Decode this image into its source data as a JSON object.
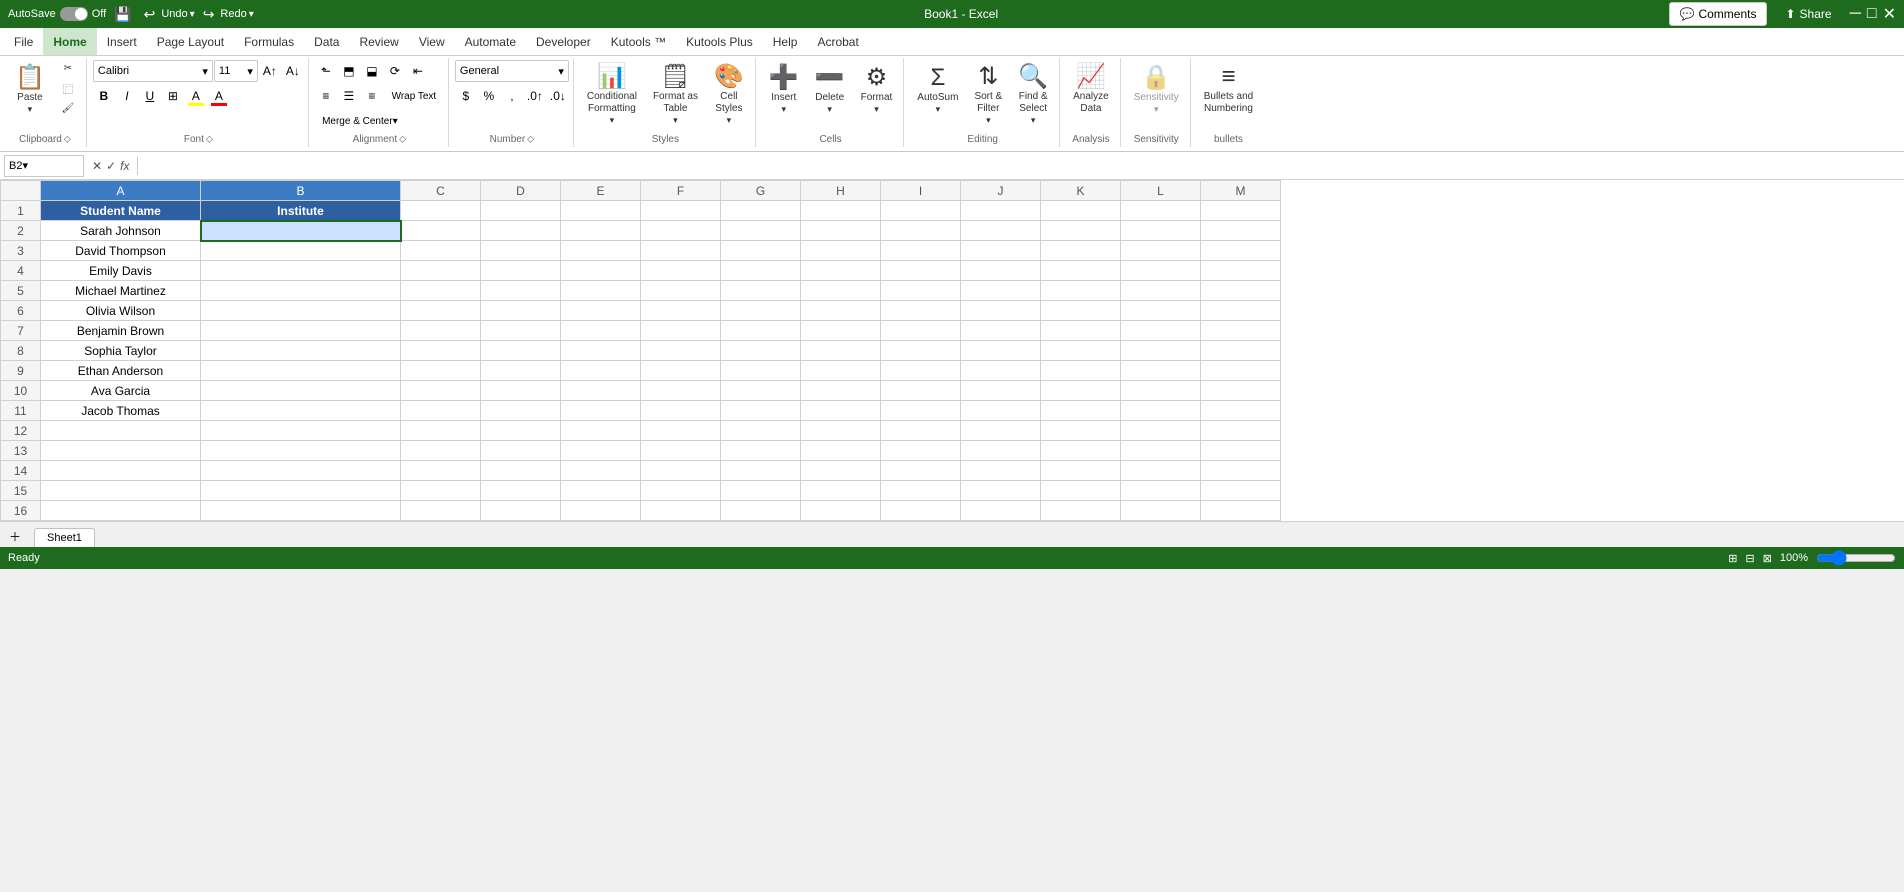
{
  "titleBar": {
    "title": "Book1 - Excel",
    "windowControls": [
      "minimize",
      "maximize",
      "close"
    ]
  },
  "quickAccess": {
    "autosave_label": "AutoSave",
    "autosave_state": "Off",
    "save_label": "Save",
    "undo_label": "Undo",
    "redo_label": "Redo"
  },
  "menuBar": {
    "items": [
      "File",
      "Home",
      "Insert",
      "Page Layout",
      "Formulas",
      "Data",
      "Review",
      "View",
      "Automate",
      "Developer",
      "Kutools ™",
      "Kutools Plus",
      "Help",
      "Acrobat"
    ]
  },
  "ribbon": {
    "groups": [
      {
        "name": "Clipboard",
        "label": "Clipboard",
        "buttons": [
          "Paste",
          "Cut",
          "Copy",
          "Format Painter"
        ]
      },
      {
        "name": "Font",
        "label": "Font",
        "fontName": "Calibri",
        "fontSize": "11",
        "bold": "B",
        "italic": "I",
        "underline": "U"
      },
      {
        "name": "Alignment",
        "label": "Alignment",
        "wrapText": "Wrap Text",
        "mergeCenterLabel": "Merge & Center"
      },
      {
        "name": "Number",
        "label": "Number",
        "format": "General"
      },
      {
        "name": "Styles",
        "label": "Styles",
        "conditionalFormatting": "Conditional Formatting",
        "formatAsTable": "Format as Table",
        "cellStyles": "Cell Styles"
      },
      {
        "name": "Cells",
        "label": "Cells",
        "insert": "Insert",
        "delete": "Delete",
        "format": "Format"
      },
      {
        "name": "Editing",
        "label": "Editing",
        "autoSum": "AutoSum",
        "sortFilter": "Sort & Filter",
        "findSelect": "Find & Select"
      },
      {
        "name": "Analysis",
        "label": "Analysis",
        "analyzeData": "Analyze Data"
      },
      {
        "name": "Sensitivity",
        "label": "Sensitivity",
        "sensitivity": "Sensitivity"
      },
      {
        "name": "bullets",
        "label": "bullets",
        "bulletsNumbering": "Bullets and Numbering"
      }
    ]
  },
  "formulaBar": {
    "cellRef": "B2",
    "formula": ""
  },
  "spreadsheet": {
    "columns": [
      "A",
      "B",
      "C",
      "D",
      "E",
      "F",
      "G",
      "H",
      "I",
      "J",
      "K",
      "L",
      "M"
    ],
    "selectedCell": "B2",
    "headers": {
      "A1": "Student Name",
      "B1": "Institute"
    },
    "data": [
      {
        "A": "Sarah Johnson",
        "B": "",
        "row": 2
      },
      {
        "A": "David Thompson",
        "B": "",
        "row": 3
      },
      {
        "A": "Emily Davis",
        "B": "",
        "row": 4
      },
      {
        "A": "Michael Martinez",
        "B": "",
        "row": 5
      },
      {
        "A": "Olivia Wilson",
        "B": "",
        "row": 6
      },
      {
        "A": "Benjamin Brown",
        "B": "",
        "row": 7
      },
      {
        "A": "Sophia Taylor",
        "B": "",
        "row": 8
      },
      {
        "A": "Ethan Anderson",
        "B": "",
        "row": 9
      },
      {
        "A": "Ava Garcia",
        "B": "",
        "row": 10
      },
      {
        "A": "Jacob Thomas",
        "B": "",
        "row": 11
      }
    ],
    "emptyRows": [
      12,
      13,
      14,
      15,
      16
    ]
  },
  "sheetTabs": {
    "tabs": [
      "Sheet1"
    ],
    "active": "Sheet1"
  },
  "statusBar": {
    "status": "Ready",
    "zoomLevel": "100%"
  },
  "topRight": {
    "comments": "Comments",
    "share": "Share"
  }
}
